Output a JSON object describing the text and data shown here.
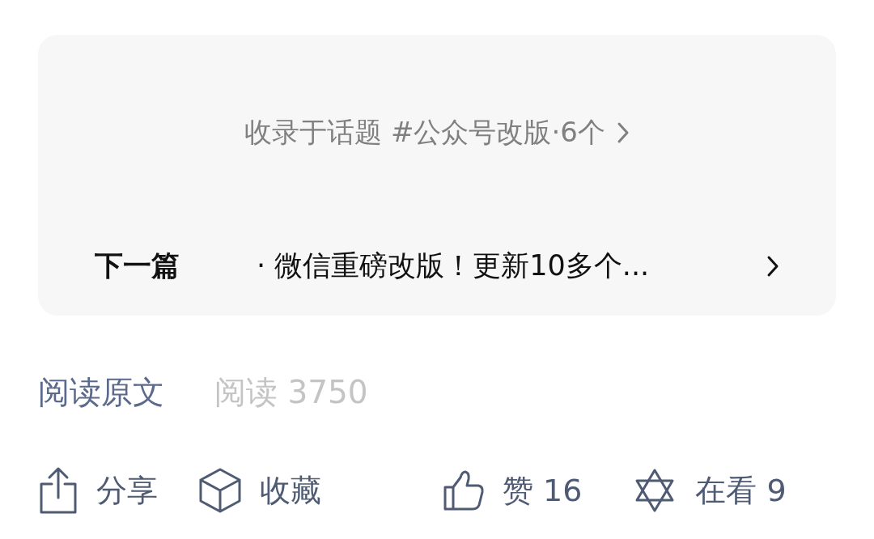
{
  "topic_card": {
    "topic": "收录于话题 #公众号改版·6个",
    "next_label": "下一篇",
    "next_title": "· 微信重磅改版！更新10多个..."
  },
  "meta": {
    "read_original": "阅读原文",
    "reads": "阅读 3750"
  },
  "actions": [
    {
      "kind": "share",
      "label": "分享"
    },
    {
      "kind": "collect",
      "label": "收藏"
    },
    {
      "kind": "like",
      "label": "赞 16"
    },
    {
      "kind": "looking",
      "label": "在看 9"
    }
  ]
}
